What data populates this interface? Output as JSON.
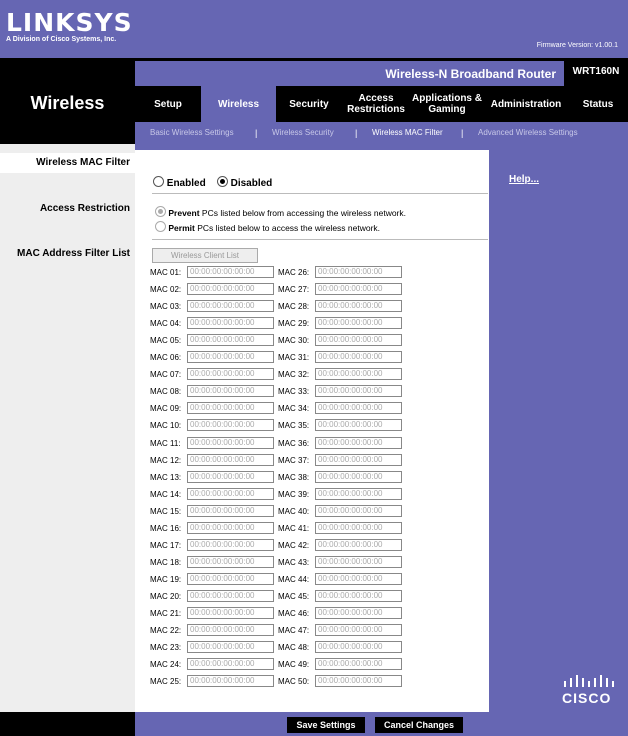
{
  "header": {
    "logo": "LINKSYS",
    "logo_subtitle": "A Division of Cisco Systems, Inc.",
    "firmware": "Firmware Version: v1.00.1",
    "product_name": "Wireless-N Broadband Router",
    "model": "WRT160N",
    "section": "Wireless"
  },
  "tabs": [
    {
      "label": "Setup"
    },
    {
      "label": "Wireless"
    },
    {
      "label": "Security"
    },
    {
      "label": "Access Restrictions"
    },
    {
      "label": "Applications & Gaming"
    },
    {
      "label": "Administration"
    },
    {
      "label": "Status"
    }
  ],
  "subtabs": [
    {
      "label": "Basic Wireless Settings"
    },
    {
      "label": "Wireless Security"
    },
    {
      "label": "Wireless MAC Filter"
    },
    {
      "label": "Advanced Wireless Settings"
    }
  ],
  "left_labels": {
    "filter": "Wireless MAC Filter",
    "access": "Access Restriction",
    "maclist": "MAC Address Filter List"
  },
  "filter": {
    "enabled_label": "Enabled",
    "disabled_label": "Disabled",
    "selected": "Disabled"
  },
  "access": {
    "prevent_bold": "Prevent",
    "prevent_text": " PCs listed below from accessing the wireless network.",
    "permit_bold": "Permit",
    "permit_text": " PCs listed below to access the wireless network."
  },
  "wireless_client_list_button": "Wireless Client List",
  "mac_placeholder": "00:00:00:00:00:00",
  "mac_labels": [
    "MAC 01:",
    "MAC 02:",
    "MAC 03:",
    "MAC 04:",
    "MAC 05:",
    "MAC 06:",
    "MAC 07:",
    "MAC 08:",
    "MAC 09:",
    "MAC 10:",
    "MAC 11:",
    "MAC 12:",
    "MAC 13:",
    "MAC 14:",
    "MAC 15:",
    "MAC 16:",
    "MAC 17:",
    "MAC 18:",
    "MAC 19:",
    "MAC 20:",
    "MAC 21:",
    "MAC 22:",
    "MAC 23:",
    "MAC 24:",
    "MAC 25:",
    "MAC 26:",
    "MAC 27:",
    "MAC 28:",
    "MAC 29:",
    "MAC 30:",
    "MAC 31:",
    "MAC 32:",
    "MAC 33:",
    "MAC 34:",
    "MAC 35:",
    "MAC 36:",
    "MAC 37:",
    "MAC 38:",
    "MAC 39:",
    "MAC 40:",
    "MAC 41:",
    "MAC 42:",
    "MAC 43:",
    "MAC 44:",
    "MAC 45:",
    "MAC 46:",
    "MAC 47:",
    "MAC 48:",
    "MAC 49:",
    "MAC 50:"
  ],
  "help": "Help...",
  "buttons": {
    "save": "Save Settings",
    "cancel": "Cancel Changes"
  },
  "brand": "CISCO",
  "colors": {
    "accent": "#6666b3",
    "dark": "#000000"
  }
}
